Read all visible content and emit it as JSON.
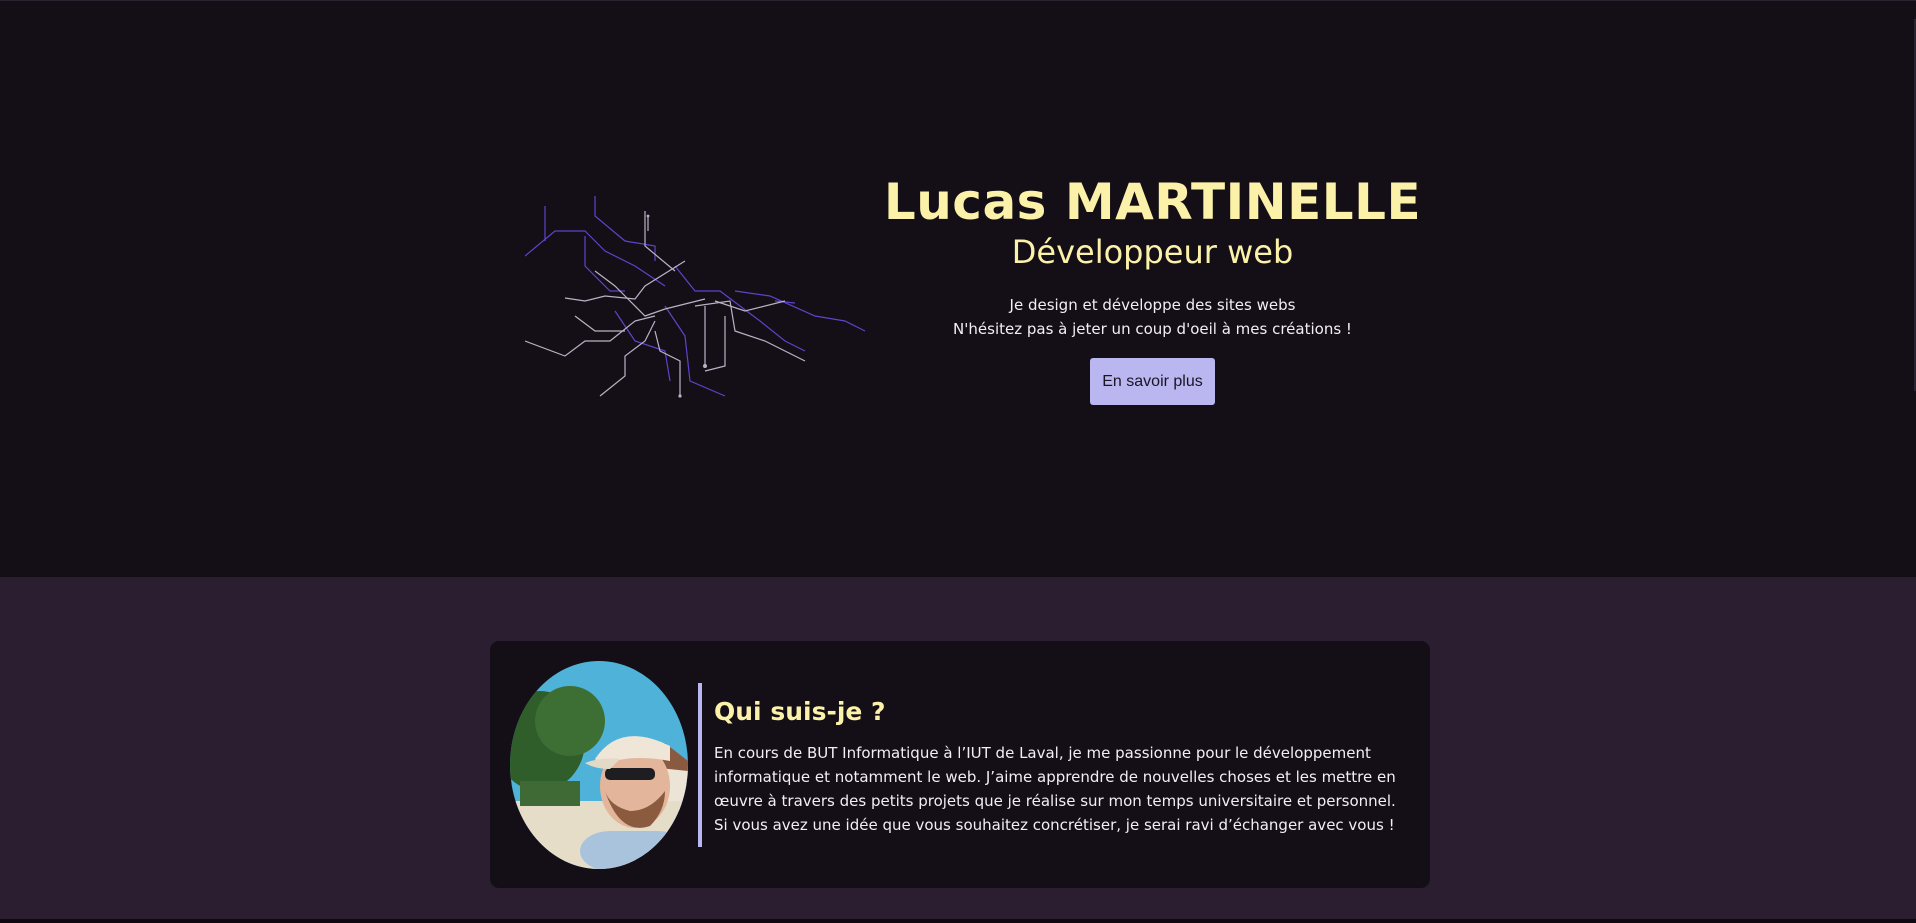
{
  "hero": {
    "name": "Lucas MARTINELLE",
    "role": "Développeur web",
    "tagline_line1": "Je design et développe des sites webs",
    "tagline_line2": "N'hésitez pas à jeter un coup d'oeil à mes créations !",
    "cta_label": "En savoir plus"
  },
  "about": {
    "title": "Qui suis-je ?",
    "text": "En cours de BUT Informatique à l’IUT de Laval, je me passionne pour le développement informatique et notamment le web. J’aime apprendre de nouvelles choses et les mettre en œuvre à travers des petits projets que je réalise sur mon temps universitaire et personnel. Si vous avez une idée que vous souhaitez concrétiser, je serai ravi d’échanger avec vous !"
  },
  "colors": {
    "hero_bg": "#140f17",
    "page_bg": "#2b1e30",
    "accent_yellow": "#fcf1a9",
    "accent_lavender": "#b9b6f0"
  },
  "icons": {
    "hero_graphic": "circuit-lines-illustration",
    "avatar": "profile-photo"
  }
}
